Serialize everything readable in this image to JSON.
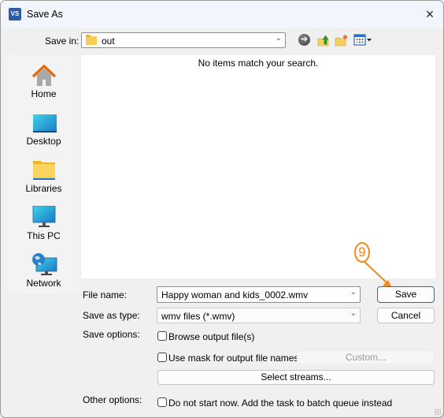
{
  "window": {
    "title": "Save As",
    "app_icon": "VS",
    "close_icon": "×"
  },
  "toolbar": {
    "save_in_label": "Save in:",
    "save_in_value": "out",
    "icons": [
      "back-icon",
      "up-folder-icon",
      "new-folder-icon",
      "view-menu-icon"
    ]
  },
  "sidebar": {
    "items": [
      {
        "label": "Home",
        "icon": "home-icon"
      },
      {
        "label": "Desktop",
        "icon": "desktop-icon"
      },
      {
        "label": "Libraries",
        "icon": "libraries-icon"
      },
      {
        "label": "This PC",
        "icon": "this-pc-icon"
      },
      {
        "label": "Network",
        "icon": "network-icon"
      }
    ]
  },
  "filelist": {
    "empty_message": "No items match your search."
  },
  "form": {
    "file_name_label": "File name:",
    "file_name_value": "Happy woman and kids_0002.wmv",
    "save_type_label": "Save as type:",
    "save_type_value": "wmv files (*.wmv)",
    "save_options_label": "Save options:",
    "browse_output_label": "Browse output file(s)",
    "browse_output_checked": false,
    "use_mask_label": "Use mask for output file names",
    "use_mask_checked": false,
    "custom_button": "Custom...",
    "select_streams_button": "Select streams...",
    "other_options_label": "Other options:",
    "batch_queue_label": "Do not start now. Add the task to batch queue instead",
    "batch_queue_checked": false
  },
  "buttons": {
    "save": "Save",
    "cancel": "Cancel"
  },
  "annotation": {
    "step_number": "9",
    "color": "#f08a1c"
  }
}
